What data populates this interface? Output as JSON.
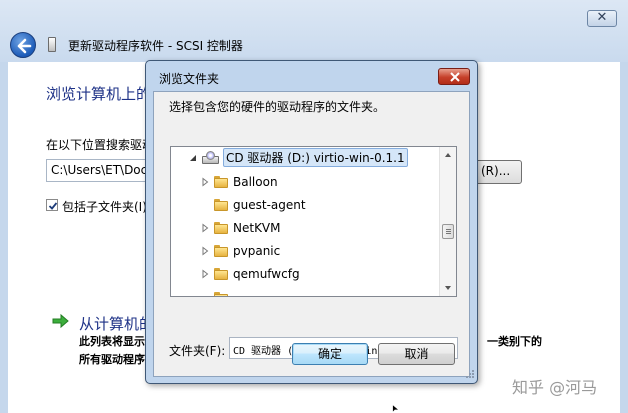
{
  "wizard": {
    "close_symbol": "✕",
    "title": "更新驱动程序软件 - SCSI 控制器",
    "heading": "浏览计算机上的",
    "search_label": "在以下位置搜索驱动",
    "path_value": "C:\\Users\\ET\\Docu",
    "browse_label": "(R)...",
    "include_subfolders_label": "包括子文件夹(I)",
    "include_subfolders_checked": true,
    "link_text": "从计算机的",
    "desc_line1": "此列表将显示",
    "desc_line1_tail": "一类别下的",
    "desc_line2": "所有驱动程序"
  },
  "dialog": {
    "title": "浏览文件夹",
    "instruction": "选择包含您的硬件的驱动程序的文件夹。",
    "tree": [
      {
        "label": "CD 驱动器 (D:) virtio-win-0.1.1",
        "icon": "cd-drive-icon",
        "expander": "expanded",
        "selected": true
      },
      {
        "label": "Balloon",
        "icon": "folder-icon",
        "expander": "collapsed"
      },
      {
        "label": "guest-agent",
        "icon": "folder-icon",
        "expander": "none"
      },
      {
        "label": "NetKVM",
        "icon": "folder-icon",
        "expander": "collapsed"
      },
      {
        "label": "pvpanic",
        "icon": "folder-icon",
        "expander": "collapsed"
      },
      {
        "label": "qemufwcfg",
        "icon": "folder-icon",
        "expander": "collapsed"
      }
    ],
    "folder_label": "文件夹(F):",
    "folder_value": "CD 驱动器 (D:) virtio-win-0.1.1",
    "ok_label": "确定",
    "cancel_label": "取消"
  },
  "watermark": "知乎 @河马"
}
